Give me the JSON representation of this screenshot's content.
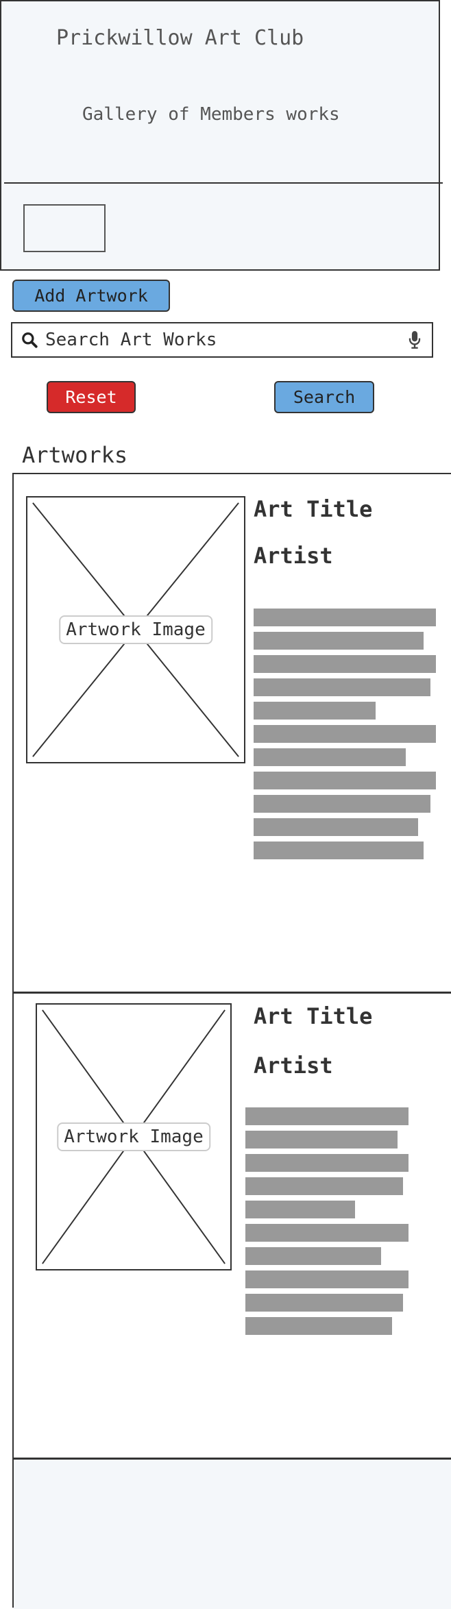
{
  "header": {
    "title": "Prickwillow Art Club",
    "subtitle": "Gallery of Members works"
  },
  "toolbar": {
    "add_label": "Add Artwork",
    "reset_label": "Reset",
    "search_label": "Search"
  },
  "search": {
    "placeholder": "Search Art Works",
    "value": ""
  },
  "gallery": {
    "heading": "Artworks",
    "artworks": [
      {
        "image_label": "Artwork Image",
        "title": "Art Title",
        "artist": "Artist"
      },
      {
        "image_label": "Artwork Image",
        "title": "Art Title",
        "artist": "Artist"
      }
    ]
  },
  "colors": {
    "primary_button": "#6aa9e0",
    "danger_button": "#d62a2a",
    "header_bg": "#f4f7fa",
    "placeholder_text": "#999999"
  }
}
